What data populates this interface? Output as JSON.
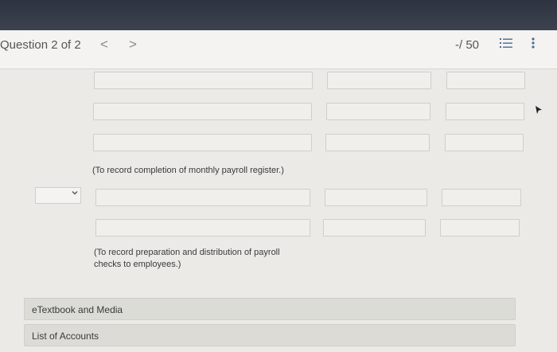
{
  "header": {
    "question_label": "Question 2 of 2",
    "prev_glyph": "<",
    "next_glyph": ">",
    "score": "-/ 50"
  },
  "notes": {
    "note1": "(To record completion of monthly payroll register.)",
    "note2": "(To record preparation and distribution of payroll checks to employees.)"
  },
  "links": {
    "textbook": "eTextbook and Media",
    "accounts": "List of Accounts"
  },
  "icons": [
    "list-icon",
    "more-vertical-icon",
    "cursor-icon",
    "chevron-down-icon"
  ]
}
